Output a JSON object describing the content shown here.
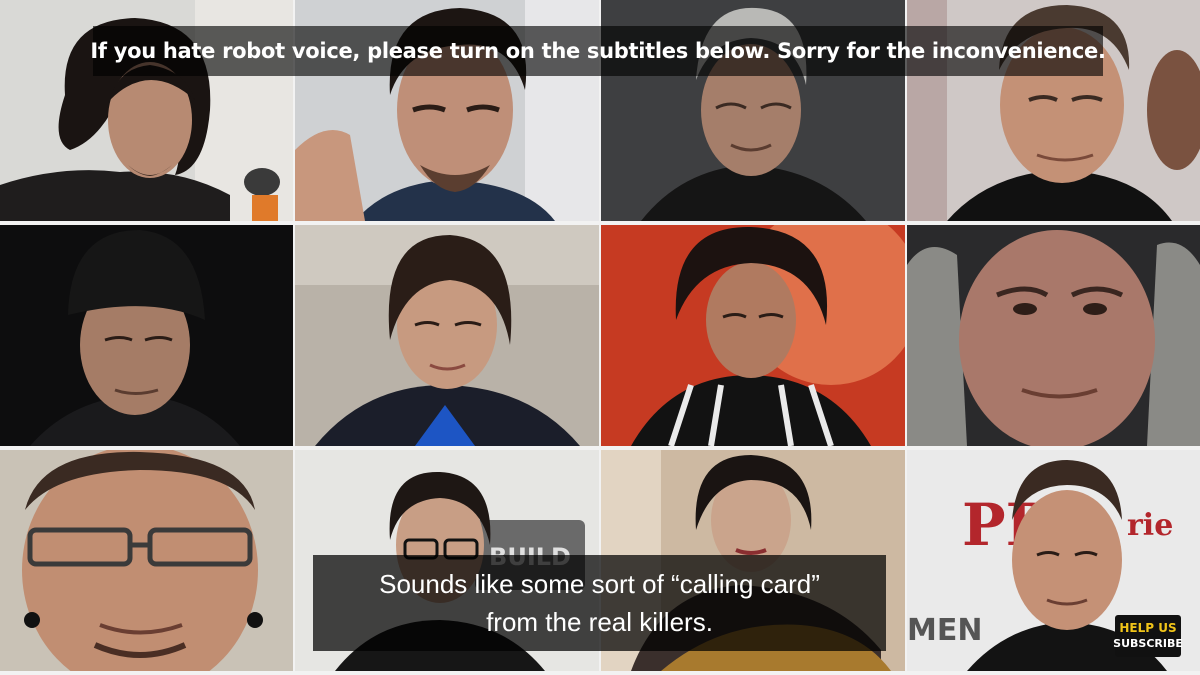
{
  "banner": {
    "text": "If you hate robot voice, please turn on the subtitles below. Sorry for the inconvenience."
  },
  "subtitle": {
    "line1": "Sounds like some sort of “calling card”",
    "line2": "from the real killers."
  },
  "badge": {
    "line1": "HELP US",
    "line2": "SUBSCRIBE"
  },
  "photo_signs": {
    "build": "BUILD",
    "pr": "PR",
    "rie": "rie",
    "men": "MEN"
  },
  "colors": {
    "badge_accent": "#f0c419",
    "overlay": "#000000"
  }
}
